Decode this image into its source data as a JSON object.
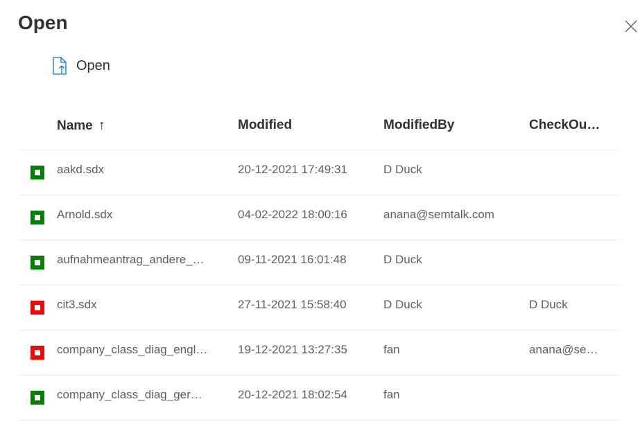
{
  "dialog": {
    "title": "Open",
    "close_icon": "close-icon"
  },
  "command": {
    "open_label": "Open",
    "open_icon": "open-file-icon"
  },
  "columns": {
    "name": "Name",
    "name_sort_icon": "↑",
    "modified": "Modified",
    "modified_by": "ModifiedBy",
    "checked_out": "CheckOu…"
  },
  "status_colors": {
    "available": "#008000",
    "checked_out": "#ff0000"
  },
  "files": [
    {
      "name": "aakd.sdx",
      "modified": "20-12-2021 17:49:31",
      "modified_by": "D Duck",
      "checked_out": "",
      "status": "available"
    },
    {
      "name": "Arnold.sdx",
      "modified": "04-02-2022 18:00:16",
      "modified_by": "anana@semtalk.com",
      "checked_out": "",
      "status": "available"
    },
    {
      "name": "aufnahmeantrag_andere_…",
      "modified": "09-11-2021 16:01:48",
      "modified_by": "D Duck",
      "checked_out": "",
      "status": "available"
    },
    {
      "name": "cit3.sdx",
      "modified": "27-11-2021 15:58:40",
      "modified_by": "D Duck",
      "checked_out": "D Duck",
      "status": "checked_out"
    },
    {
      "name": "company_class_diag_engl…",
      "modified": "19-12-2021 13:27:35",
      "modified_by": "fan",
      "checked_out": "anana@se…",
      "status": "checked_out"
    },
    {
      "name": "company_class_diag_ger…",
      "modified": "20-12-2021 18:02:54",
      "modified_by": "fan",
      "checked_out": "",
      "status": "available"
    }
  ]
}
